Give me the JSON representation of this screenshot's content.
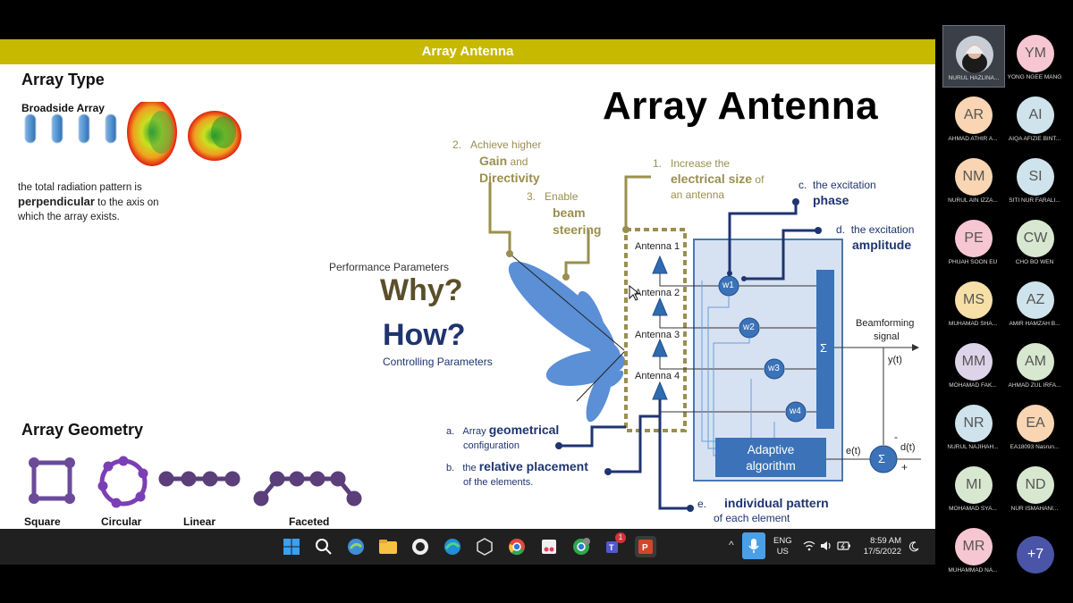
{
  "slide": {
    "banner": "Array Antenna",
    "array_type": {
      "heading": "Array Type",
      "subheading": "Broadside Array",
      "desc_1": "the total radiation pattern is",
      "desc_bold": "perpendicular",
      "desc_2": " to the axis on",
      "desc_3": "which the array exists."
    },
    "array_geometry": {
      "heading": "Array Geometry",
      "labels": [
        "Square",
        "Circular",
        "Linear",
        "Faceted"
      ]
    },
    "big_title": "Array Antenna",
    "performance_label": "Performance Parameters",
    "why": "Why?",
    "how": "How?",
    "controlling_label": "Controlling Parameters",
    "perf": {
      "p2_num": "2.",
      "p2_l1": "Achieve higher",
      "p2_gain": "Gain",
      "p2_and": " and",
      "p2_dir": "Directivity",
      "p3_num": "3.",
      "p3_l1": "Enable",
      "p3_l2": "beam",
      "p3_l3": "steering",
      "p1_num": "1.",
      "p1_l1": "Increase the",
      "p1_bold": "electrical size",
      "p1_of": " of",
      "p1_l3": "an antenna"
    },
    "ctrl": {
      "c_prefix": "c.",
      "c_l1": "the excitation",
      "c_bold": "phase",
      "d_prefix": "d.",
      "d_l1": "the excitation",
      "d_bold": "amplitude",
      "a_prefix": "a.",
      "a_l1": "Array ",
      "a_bold": "geometrical",
      "a_l2": "configuration",
      "b_prefix": "b.",
      "b_l1": "the ",
      "b_bold": "relative placement",
      "b_l2": "of the elements.",
      "e_prefix": "e.",
      "e_bold": "individual pattern",
      "e_l2": "of each element"
    },
    "diagram": {
      "antennas": [
        "Antenna 1",
        "Antenna 2",
        "Antenna 3",
        "Antenna 4"
      ],
      "weights": [
        "w1",
        "w2",
        "w3",
        "w4"
      ],
      "sum_symbol": "Σ",
      "beamforming": "Beamforming",
      "signal": "signal",
      "yt": "y(t)",
      "et": "e(t)",
      "dt": "d(t)",
      "minus": "-",
      "plus": "+",
      "adaptive_1": "Adaptive",
      "adaptive_2": "algorithm"
    }
  },
  "taskbar": {
    "lang_1": "ENG",
    "lang_2": "US",
    "time": "8:59 AM",
    "date": "17/5/2022",
    "teams_badge": "1"
  },
  "participants": [
    {
      "initials": "",
      "name": "NURUL HAZLINA...",
      "color": "#5a6a7a"
    },
    {
      "initials": "YM",
      "name": "YONG NGEE MANG",
      "color": "#f7c6d3"
    },
    {
      "initials": "AR",
      "name": "AHMAD ATHIR A...",
      "color": "#f9d5b3"
    },
    {
      "initials": "AI",
      "name": "AIQA AFIZIE BINT...",
      "color": "#cfe3ec"
    },
    {
      "initials": "NM",
      "name": "NURUL AIN IZZA...",
      "color": "#f9d5b3"
    },
    {
      "initials": "SI",
      "name": "SITI NUR FARALI...",
      "color": "#cfe3ec"
    },
    {
      "initials": "PE",
      "name": "PHUAH SOON EU",
      "color": "#f7c6d3"
    },
    {
      "initials": "CW",
      "name": "CHO BO WEN",
      "color": "#d8e8d0"
    },
    {
      "initials": "MS",
      "name": "MUHAMAD SHA...",
      "color": "#f6e0a8"
    },
    {
      "initials": "AZ",
      "name": "AMIR HAMZAH B...",
      "color": "#cfe3ec"
    },
    {
      "initials": "MM",
      "name": "MOHAMAD FAK...",
      "color": "#ddd4ea"
    },
    {
      "initials": "AM",
      "name": "AHMAD ZUL IRFA...",
      "color": "#d8e8d0"
    },
    {
      "initials": "NR",
      "name": "NURUL NAJIHAH...",
      "color": "#cfe3ec"
    },
    {
      "initials": "EA",
      "name": "EA18093 Nasrun...",
      "color": "#f9d5b3"
    },
    {
      "initials": "MI",
      "name": "MOHAMAD SYA...",
      "color": "#d8e8d0"
    },
    {
      "initials": "ND",
      "name": "NUR ISMAHANI...",
      "color": "#d8e8d0"
    },
    {
      "initials": "MR",
      "name": "MUHAMMAD NA...",
      "color": "#f7c6d3"
    },
    {
      "initials": "+7",
      "name": "",
      "color": "#4a55a8"
    }
  ]
}
